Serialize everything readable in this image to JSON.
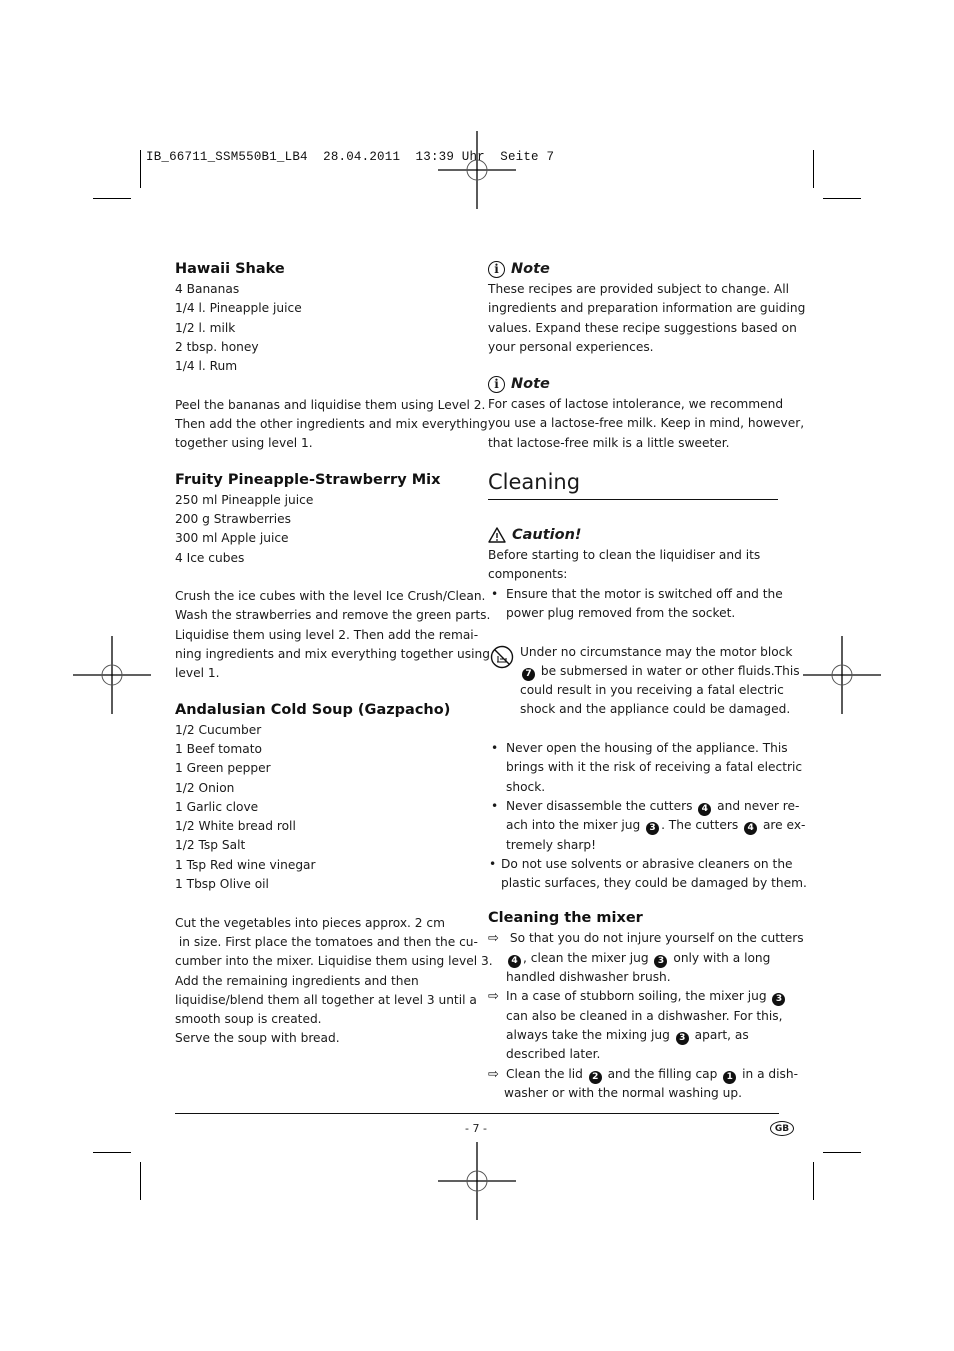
{
  "slug": "IB_66711_SSM550B1_LB4  28.04.2011  13:39 Uhr  Seite 7",
  "left": {
    "recipes": [
      {
        "title": "Hawaii Shake",
        "ingredients": [
          "4 Bananas",
          "1/4 l. Pineapple juice",
          "1/2 l. milk",
          "2 tbsp. honey",
          "1/4 l. Rum"
        ],
        "method": [
          "Peel the bananas and liquidise them using Level 2.",
          "Then add the other ingredients and mix everything",
          "together using level 1."
        ]
      },
      {
        "title": "Fruity Pineapple-Strawberry Mix",
        "ingredients": [
          "250 ml Pineapple juice",
          "200 g Strawberries",
          "300 ml Apple juice",
          "4 Ice cubes"
        ],
        "method": [
          "Crush the ice cubes with the level Ice Crush/Clean.",
          "Wash the strawberries and remove the green parts.",
          "Liquidise them using level 2. Then add the remai-",
          "ning ingredients and mix everything together using",
          "level 1."
        ]
      },
      {
        "title": "Andalusian Cold Soup (Gazpacho)",
        "ingredients": [
          "1/2 Cucumber",
          "1 Beef tomato",
          "1 Green pepper",
          "1/2 Onion",
          "1 Garlic clove",
          "1/2 White bread roll",
          "1/2 Tsp Salt",
          "1 Tsp Red wine vinegar",
          "1 Tbsp Olive oil"
        ],
        "method": [
          "Cut the vegetables into pieces approx. 2 cm",
          " in size. First place the tomatoes and then the cu-",
          "cumber into the mixer. Liquidise them using level 3.",
          "Add the remaining ingredients and then",
          "liquidise/blend them all together at level 3 until a",
          "smooth soup is created.",
          "Serve the soup with bread."
        ]
      }
    ]
  },
  "right": {
    "notes": [
      {
        "icon": "info-icon",
        "title": "Note",
        "lines": [
          "These recipes are provided subject to change. All",
          "ingredients and preparation information are guiding",
          "values. Expand these recipe suggestions based on",
          "your personal experiences."
        ]
      },
      {
        "icon": "info-icon",
        "title": "Note",
        "lines": [
          "For cases of lactose intolerance, we recommend",
          "you use a lactose-free milk. Keep in mind, however,",
          "that lactose-free milk is a little sweeter."
        ]
      }
    ],
    "section_title": "Cleaning",
    "caution": {
      "icon": "warning-triangle-icon",
      "title": "Caution!",
      "intro": [
        "Before starting to clean the liquidiser and its",
        "components:"
      ],
      "bullet1": [
        "Ensure that the motor is switched off and the",
        "power plug removed from the socket."
      ],
      "nosubmerge": {
        "icon": "no-submerge-icon",
        "l1": "Under no circumstance may the motor block",
        "l2_num": "7",
        "l2": " be submersed in water or other fluids.This",
        "l3": "could result in you receiving a fatal electric",
        "l4": "shock and the appliance could be damaged."
      },
      "bullet2": [
        "Never open the housing of the appliance. This",
        "brings with it the risk of receiving a fatal electric",
        "shock."
      ],
      "bullet3": {
        "a": "Never disassemble the cutters ",
        "n1": "4",
        "b": " and never re-",
        "c": "ach into the mixer jug ",
        "n2": "3",
        "d": ". The cutters ",
        "n3": "4",
        "e": " are ex-",
        "f": "tremely sharp!"
      },
      "bullet4": [
        "Do not use solvents or abrasive cleaners on the",
        "plastic surfaces, they could be damaged by them."
      ]
    },
    "mixer": {
      "title": "Cleaning the mixer",
      "arrow": "⇨",
      "item1": {
        "a": " So that you do not injure yourself on the cutters",
        "n1": "4",
        "b": ", clean the mixer jug ",
        "n2": "3",
        "c": " only with a long",
        "d": "handled dishwasher brush."
      },
      "item2": {
        "a": "In a case of stubborn soiling, the mixer jug ",
        "n1": "3",
        "b": "can also be cleaned in a dishwasher. For this,",
        "c": "always take the mixing jug ",
        "n2": "3",
        "d": " apart, as",
        "e": "described later."
      },
      "item3": {
        "a": "Clean the lid ",
        "n1": "2",
        "b": " and the filling cap ",
        "n2": "1",
        "c": " in a dish-",
        "d": "washer or with the normal washing up."
      }
    }
  },
  "footer": {
    "page": "- 7 -",
    "lang": "GB"
  }
}
